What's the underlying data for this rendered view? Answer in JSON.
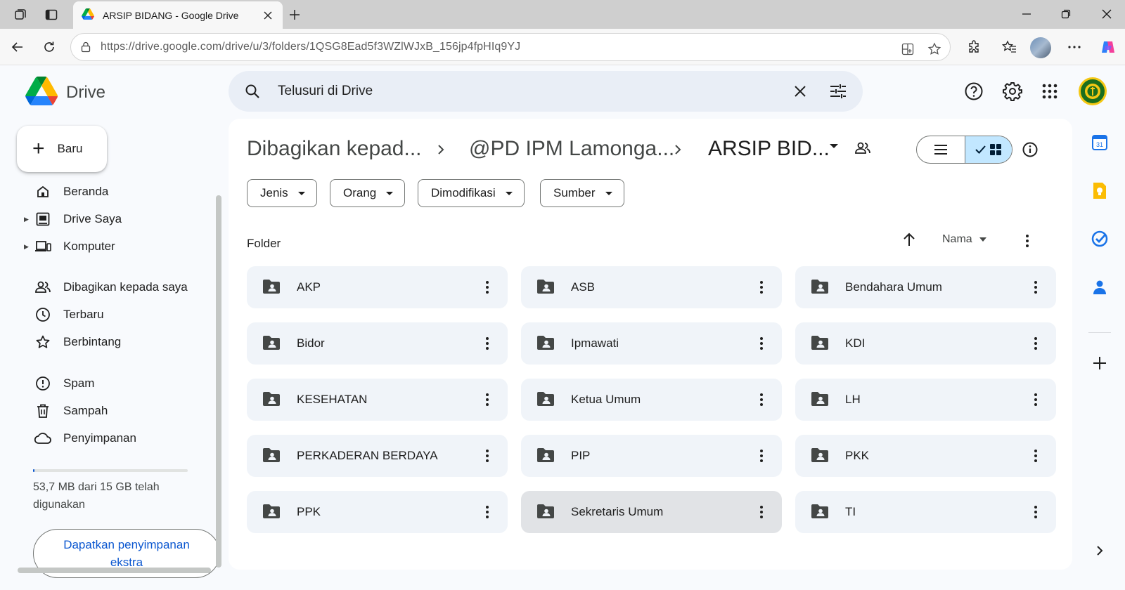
{
  "browser": {
    "tab_title": "ARSIP BIDANG - Google Drive",
    "url_host": "https://drive.google.com",
    "url_path": "/drive/u/3/folders/1QSG8Ead5f3WZlWJxB_156jp4fpHIq9YJ"
  },
  "app": {
    "name": "Drive",
    "search_placeholder": "Telusuri di Drive"
  },
  "sidebar": {
    "new_label": "Baru",
    "items": [
      {
        "label": "Beranda",
        "icon": "home-icon"
      },
      {
        "label": "Drive Saya",
        "icon": "my-drive-icon"
      },
      {
        "label": "Komputer",
        "icon": "computer-icon"
      },
      {
        "label": "Dibagikan kepada saya",
        "icon": "shared-icon"
      },
      {
        "label": "Terbaru",
        "icon": "clock-icon"
      },
      {
        "label": "Berbintang",
        "icon": "star-icon"
      },
      {
        "label": "Spam",
        "icon": "spam-icon"
      },
      {
        "label": "Sampah",
        "icon": "trash-icon"
      },
      {
        "label": "Penyimpanan",
        "icon": "cloud-icon"
      }
    ],
    "storage_text": "53,7 MB dari 15 GB telah digunakan",
    "storage_fraction": 0.0036,
    "storage_button": "Dapatkan penyimpanan ekstra"
  },
  "breadcrumb": {
    "items": [
      "Dibagikan kepad...",
      "@PD IPM Lamonga...",
      "ARSIP BID..."
    ]
  },
  "filters": [
    "Jenis",
    "Orang",
    "Dimodifikasi",
    "Sumber"
  ],
  "section": {
    "title": "Folder",
    "sort_label": "Nama"
  },
  "folders": [
    "AKP",
    "ASB",
    "Bendahara Umum",
    "Bidor",
    "Ipmawati",
    "KDI",
    "KESEHATAN",
    "Ketua Umum",
    "LH",
    "PERKADERAN BERDAYA",
    "PIP",
    "PKK",
    "PPK",
    "Sekretaris Umum",
    "TI"
  ],
  "selected_folder": "Sekretaris Umum",
  "colors": {
    "accent": "#0b57d0",
    "toggle_active": "#c2e7ff",
    "folder_bg": "#f0f4f9",
    "search_bg": "#e9eef6"
  }
}
